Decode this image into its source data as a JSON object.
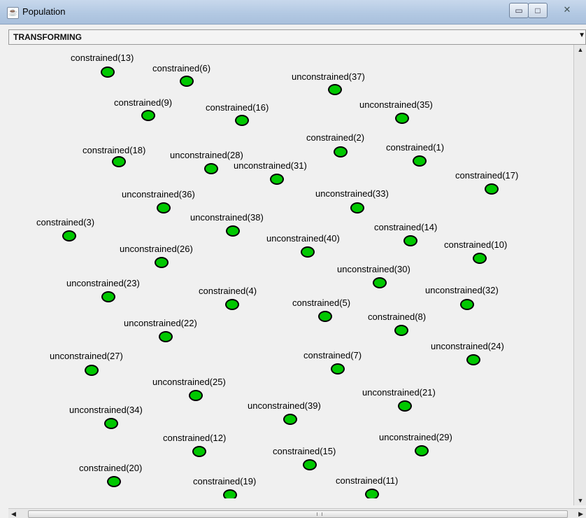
{
  "window": {
    "title": "Population",
    "minimize_glyph": "▭",
    "maximize_glyph": "□",
    "close_glyph": "✕"
  },
  "state_bar": {
    "label": "TRANSFORMING",
    "dropdown_glyph": "▼"
  },
  "scrollbars": {
    "up_glyph": "▲",
    "down_glyph": "▼",
    "left_glyph": "◀",
    "right_glyph": "▶"
  },
  "colors": {
    "node_fill": "#00c800",
    "node_border": "#000000"
  },
  "nodes": [
    {
      "label": "constrained(13)"
    },
    {
      "label": "constrained(6)"
    },
    {
      "label": "unconstrained(37)"
    },
    {
      "label": "constrained(9)"
    },
    {
      "label": "constrained(16)"
    },
    {
      "label": "unconstrained(35)"
    },
    {
      "label": "constrained(2)"
    },
    {
      "label": "constrained(1)"
    },
    {
      "label": "constrained(18)"
    },
    {
      "label": "unconstrained(28)"
    },
    {
      "label": "unconstrained(31)"
    },
    {
      "label": "constrained(17)"
    },
    {
      "label": "unconstrained(36)"
    },
    {
      "label": "unconstrained(33)"
    },
    {
      "label": "unconstrained(38)"
    },
    {
      "label": "constrained(3)"
    },
    {
      "label": "constrained(14)"
    },
    {
      "label": "unconstrained(40)"
    },
    {
      "label": "constrained(10)"
    },
    {
      "label": "unconstrained(26)"
    },
    {
      "label": "unconstrained(30)"
    },
    {
      "label": "unconstrained(23)"
    },
    {
      "label": "constrained(4)"
    },
    {
      "label": "unconstrained(32)"
    },
    {
      "label": "constrained(5)"
    },
    {
      "label": "constrained(8)"
    },
    {
      "label": "unconstrained(22)"
    },
    {
      "label": "unconstrained(24)"
    },
    {
      "label": "unconstrained(27)"
    },
    {
      "label": "constrained(7)"
    },
    {
      "label": "unconstrained(25)"
    },
    {
      "label": "unconstrained(21)"
    },
    {
      "label": "unconstrained(34)"
    },
    {
      "label": "unconstrained(39)"
    },
    {
      "label": "constrained(12)"
    },
    {
      "label": "unconstrained(29)"
    },
    {
      "label": "constrained(15)"
    },
    {
      "label": "constrained(20)"
    },
    {
      "label": "constrained(19)"
    },
    {
      "label": "constrained(11)"
    }
  ]
}
